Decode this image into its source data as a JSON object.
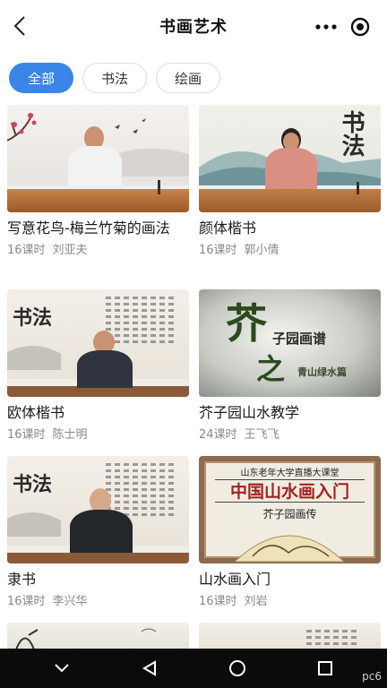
{
  "header": {
    "title": "书画艺术"
  },
  "tabs": [
    {
      "label": "全部",
      "active": true
    },
    {
      "label": "书法",
      "active": false
    },
    {
      "label": "绘画",
      "active": false
    }
  ],
  "courses": [
    {
      "title": "写意花鸟-梅兰竹菊的画法",
      "lessons": "16课时",
      "teacher": "刘亚夫"
    },
    {
      "title": "颜体楷书",
      "lessons": "16课时",
      "teacher": "郭小倩"
    },
    {
      "title": "欧体楷书",
      "lessons": "16课时",
      "teacher": "陈士明"
    },
    {
      "title": "芥子园山水教学",
      "lessons": "24课时",
      "teacher": "王飞飞"
    },
    {
      "title": "隶书",
      "lessons": "16课时",
      "teacher": "李兴华"
    },
    {
      "title": "山水画入门",
      "lessons": "16课时",
      "teacher": "刘岩"
    }
  ],
  "thumb_text": {
    "calligraphy": "书法",
    "jieziyuan_main": "芥",
    "jieziyuan_sub": "子园画谱",
    "jieziyuan_zhi": "之",
    "jieziyuan_tail": "青山绿水篇",
    "shanshui_banner": "山东老年大学直播大课堂",
    "shanshui_title": "中国山水画入门",
    "shanshui_sub": "芥子园画传"
  },
  "watermark": "pc6"
}
